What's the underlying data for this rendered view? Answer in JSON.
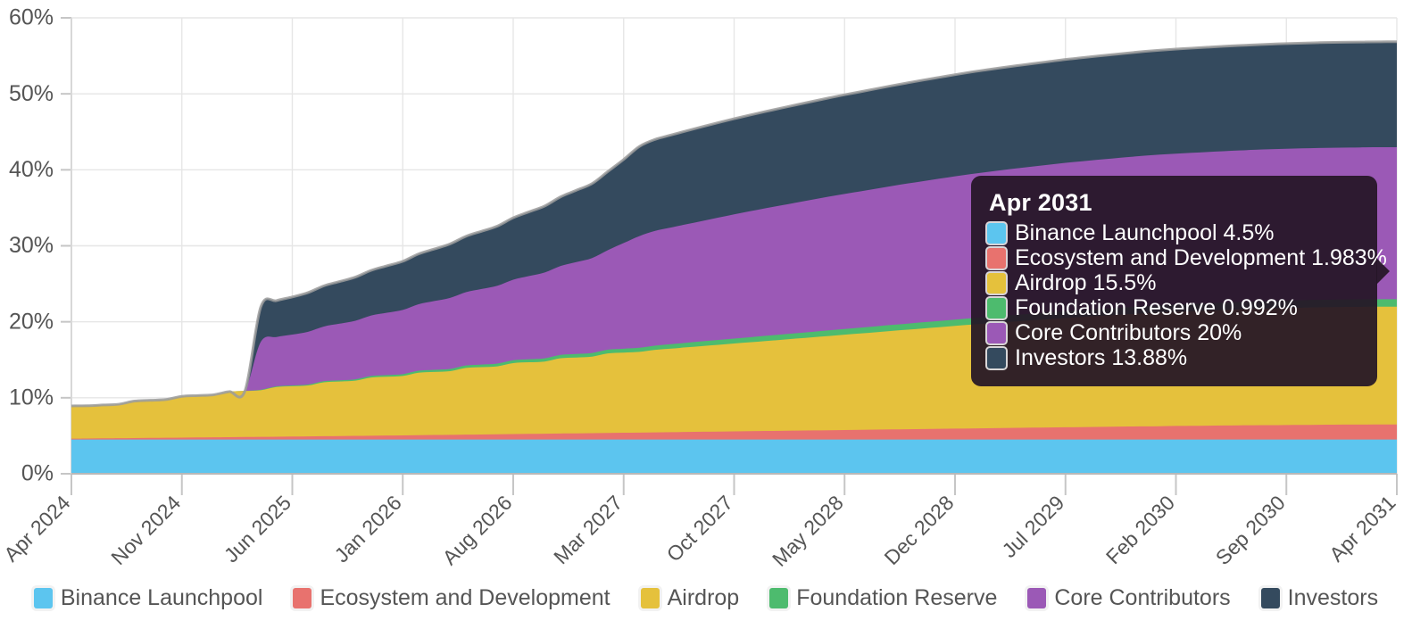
{
  "chart_data": {
    "type": "area",
    "title": "",
    "xlabel": "",
    "ylabel": "",
    "stacked": true,
    "grid": true,
    "legend_position": "bottom",
    "ylim": [
      0,
      60
    ],
    "ytick_labels": [
      "0%",
      "10%",
      "20%",
      "30%",
      "40%",
      "50%",
      "60%"
    ],
    "ytick_values": [
      0,
      10,
      20,
      30,
      40,
      50,
      60
    ],
    "xtick_labels": [
      "Apr 2024",
      "Nov 2024",
      "Jun 2025",
      "Jan 2026",
      "Aug 2026",
      "Mar 2027",
      "Oct 2027",
      "May 2028",
      "Dec 2028",
      "Jul 2029",
      "Feb 2030",
      "Sep 2030",
      "Apr 2031"
    ],
    "x": [
      "Apr 2024",
      "May 2024",
      "Jun 2024",
      "Jul 2024",
      "Aug 2024",
      "Sep 2024",
      "Oct 2024",
      "Nov 2024",
      "Dec 2024",
      "Jan 2025",
      "Feb 2025",
      "Mar 2025",
      "Apr 2025",
      "May 2025",
      "Jun 2025",
      "Jul 2025",
      "Aug 2025",
      "Sep 2025",
      "Oct 2025",
      "Nov 2025",
      "Dec 2025",
      "Jan 2026",
      "Feb 2026",
      "Mar 2026",
      "Apr 2026",
      "May 2026",
      "Jun 2026",
      "Jul 2026",
      "Aug 2026",
      "Sep 2026",
      "Oct 2026",
      "Nov 2026",
      "Dec 2026",
      "Jan 2027",
      "Feb 2027",
      "Mar 2027",
      "Apr 2027",
      "May 2027",
      "Jun 2027",
      "Jul 2027",
      "Aug 2027",
      "Sep 2027",
      "Oct 2027",
      "Nov 2027",
      "Dec 2027",
      "Jan 2028",
      "Feb 2028",
      "Mar 2028",
      "Apr 2028",
      "May 2028",
      "Jun 2028",
      "Jul 2028",
      "Aug 2028",
      "Sep 2028",
      "Oct 2028",
      "Nov 2028",
      "Dec 2028",
      "Jan 2029",
      "Feb 2029",
      "Mar 2029",
      "Apr 2029",
      "May 2029",
      "Jun 2029",
      "Jul 2029",
      "Aug 2029",
      "Sep 2029",
      "Oct 2029",
      "Nov 2029",
      "Dec 2029",
      "Jan 2030",
      "Feb 2030",
      "Mar 2030",
      "Apr 2030",
      "May 2030",
      "Jun 2030",
      "Jul 2030",
      "Aug 2030",
      "Sep 2030",
      "Oct 2030",
      "Nov 2030",
      "Dec 2030",
      "Jan 2031",
      "Feb 2031",
      "Mar 2031",
      "Apr 2031"
    ],
    "series": [
      {
        "name": "Binance Launchpool",
        "color": "#5cc5ef",
        "final_value": 4.5,
        "values": [
          4.5,
          4.5,
          4.5,
          4.5,
          4.5,
          4.5,
          4.5,
          4.5,
          4.5,
          4.5,
          4.5,
          4.5,
          4.5,
          4.5,
          4.5,
          4.5,
          4.5,
          4.5,
          4.5,
          4.5,
          4.5,
          4.5,
          4.5,
          4.5,
          4.5,
          4.5,
          4.5,
          4.5,
          4.5,
          4.5,
          4.5,
          4.5,
          4.5,
          4.5,
          4.5,
          4.5,
          4.5,
          4.5,
          4.5,
          4.5,
          4.5,
          4.5,
          4.5,
          4.5,
          4.5,
          4.5,
          4.5,
          4.5,
          4.5,
          4.5,
          4.5,
          4.5,
          4.5,
          4.5,
          4.5,
          4.5,
          4.5,
          4.5,
          4.5,
          4.5,
          4.5,
          4.5,
          4.5,
          4.5,
          4.5,
          4.5,
          4.5,
          4.5,
          4.5,
          4.5,
          4.5,
          4.5,
          4.5,
          4.5,
          4.5,
          4.5,
          4.5,
          4.5,
          4.5,
          4.5,
          4.5,
          4.5,
          4.5,
          4.5,
          4.5
        ]
      },
      {
        "name": "Ecosystem and Development",
        "color": "#e8726e",
        "final_value": 1.983,
        "values": [
          0.12,
          0.14,
          0.16,
          0.18,
          0.2,
          0.22,
          0.24,
          0.26,
          0.28,
          0.3,
          0.32,
          0.34,
          0.36,
          0.38,
          0.4,
          0.42,
          0.44,
          0.46,
          0.49,
          0.51,
          0.53,
          0.55,
          0.58,
          0.6,
          0.62,
          0.65,
          0.67,
          0.7,
          0.72,
          0.75,
          0.77,
          0.8,
          0.82,
          0.85,
          0.87,
          0.9,
          0.92,
          0.95,
          0.97,
          1.0,
          1.03,
          1.05,
          1.08,
          1.1,
          1.13,
          1.15,
          1.18,
          1.21,
          1.23,
          1.26,
          1.28,
          1.31,
          1.34,
          1.36,
          1.39,
          1.41,
          1.44,
          1.46,
          1.49,
          1.52,
          1.54,
          1.57,
          1.59,
          1.62,
          1.64,
          1.67,
          1.69,
          1.72,
          1.74,
          1.76,
          1.79,
          1.81,
          1.83,
          1.85,
          1.87,
          1.89,
          1.9,
          1.92,
          1.93,
          1.95,
          1.96,
          1.97,
          1.975,
          1.98,
          1.983
        ]
      },
      {
        "name": "Airdrop",
        "color": "#e5c13c",
        "final_value": 15.5,
        "values": [
          4.3,
          4.3,
          4.38,
          4.46,
          4.86,
          4.94,
          5.02,
          5.42,
          5.5,
          5.58,
          5.98,
          6.06,
          6.14,
          6.54,
          6.62,
          6.7,
          7.1,
          7.18,
          7.26,
          7.66,
          7.74,
          7.82,
          8.22,
          8.3,
          8.38,
          8.78,
          8.86,
          8.94,
          9.34,
          9.42,
          9.5,
          9.9,
          9.98,
          10.06,
          10.46,
          10.54,
          10.62,
          10.85,
          11.0,
          11.14,
          11.28,
          11.42,
          11.56,
          11.7,
          11.84,
          11.98,
          12.12,
          12.26,
          12.4,
          12.54,
          12.68,
          12.82,
          12.96,
          13.1,
          13.24,
          13.38,
          13.52,
          13.66,
          13.78,
          13.9,
          14.02,
          14.14,
          14.26,
          14.38,
          14.48,
          14.58,
          14.68,
          14.78,
          14.88,
          14.96,
          15.02,
          15.08,
          15.14,
          15.2,
          15.26,
          15.31,
          15.36,
          15.4,
          15.43,
          15.45,
          15.47,
          15.48,
          15.49,
          15.5,
          15.5
        ]
      },
      {
        "name": "Foundation Reserve",
        "color": "#4dbb6e",
        "final_value": 0.992,
        "values": [
          0.01,
          0.01,
          0.01,
          0.01,
          0.01,
          0.01,
          0.01,
          0.01,
          0.01,
          0.01,
          0.01,
          0.01,
          0.05,
          0.08,
          0.1,
          0.12,
          0.14,
          0.16,
          0.18,
          0.2,
          0.22,
          0.24,
          0.26,
          0.28,
          0.3,
          0.32,
          0.34,
          0.36,
          0.38,
          0.4,
          0.42,
          0.44,
          0.46,
          0.48,
          0.5,
          0.52,
          0.54,
          0.56,
          0.58,
          0.6,
          0.62,
          0.64,
          0.65,
          0.67,
          0.68,
          0.7,
          0.71,
          0.72,
          0.74,
          0.75,
          0.76,
          0.77,
          0.79,
          0.8,
          0.81,
          0.82,
          0.83,
          0.84,
          0.85,
          0.86,
          0.87,
          0.88,
          0.89,
          0.9,
          0.91,
          0.92,
          0.925,
          0.93,
          0.94,
          0.945,
          0.95,
          0.955,
          0.96,
          0.963,
          0.966,
          0.97,
          0.973,
          0.976,
          0.979,
          0.982,
          0.984,
          0.986,
          0.988,
          0.99,
          0.992
        ]
      },
      {
        "name": "Core Contributors",
        "color": "#9b59b6",
        "final_value": 20.0,
        "values": [
          0,
          0,
          0,
          0,
          0,
          0,
          0,
          0,
          0,
          0,
          0,
          0,
          6.3,
          6.5,
          6.7,
          6.95,
          7.2,
          7.45,
          7.7,
          7.95,
          8.2,
          8.45,
          8.75,
          9.05,
          9.35,
          9.65,
          9.95,
          10.25,
          10.6,
          10.95,
          11.3,
          11.7,
          12.1,
          12.5,
          13.1,
          13.9,
          14.7,
          15.1,
          15.35,
          15.6,
          15.85,
          16.1,
          16.35,
          16.58,
          16.8,
          17.0,
          17.2,
          17.4,
          17.6,
          17.78,
          17.95,
          18.12,
          18.28,
          18.44,
          18.58,
          18.72,
          18.85,
          18.98,
          19.08,
          19.18,
          19.28,
          19.36,
          19.44,
          19.52,
          19.58,
          19.64,
          19.7,
          19.75,
          19.8,
          19.84,
          19.87,
          19.9,
          19.92,
          19.94,
          19.95,
          19.96,
          19.97,
          19.98,
          19.985,
          19.99,
          19.99,
          19.995,
          20.0,
          20.0,
          20.0
        ]
      },
      {
        "name": "Investors",
        "color": "#344a5e",
        "final_value": 13.88,
        "values": [
          0,
          0,
          0,
          0,
          0,
          0,
          0,
          0,
          0,
          0,
          0,
          0,
          4.6,
          4.78,
          4.95,
          5.15,
          5.35,
          5.55,
          5.75,
          5.95,
          6.18,
          6.4,
          6.62,
          6.85,
          7.1,
          7.35,
          7.6,
          7.85,
          8.15,
          8.45,
          8.75,
          9.1,
          9.45,
          9.8,
          10.35,
          11.0,
          11.8,
          12.05,
          12.18,
          12.3,
          12.4,
          12.5,
          12.58,
          12.66,
          12.73,
          12.8,
          12.87,
          12.93,
          12.99,
          13.05,
          13.1,
          13.15,
          13.2,
          13.25,
          13.3,
          13.34,
          13.38,
          13.42,
          13.46,
          13.49,
          13.52,
          13.55,
          13.58,
          13.61,
          13.63,
          13.65,
          13.68,
          13.7,
          13.72,
          13.74,
          13.76,
          13.77,
          13.79,
          13.8,
          13.81,
          13.82,
          13.83,
          13.84,
          13.85,
          13.86,
          13.86,
          13.87,
          13.87,
          13.88,
          13.88
        ]
      }
    ]
  },
  "tooltip": {
    "title": "Apr 2031",
    "rows": [
      {
        "color": "#5cc5ef",
        "text": "Binance Launchpool 4.5%"
      },
      {
        "color": "#e8726e",
        "text": "Ecosystem and Development 1.983%"
      },
      {
        "color": "#e5c13c",
        "text": "Airdrop 15.5%"
      },
      {
        "color": "#4dbb6e",
        "text": "Foundation Reserve 0.992%"
      },
      {
        "color": "#9b59b6",
        "text": "Core Contributors 20%"
      },
      {
        "color": "#344a5e",
        "text": "Investors 13.88%"
      }
    ]
  },
  "legend": {
    "items": [
      {
        "color": "#5cc5ef",
        "label": "Binance Launchpool"
      },
      {
        "color": "#e8726e",
        "label": "Ecosystem and Development"
      },
      {
        "color": "#e5c13c",
        "label": "Airdrop"
      },
      {
        "color": "#4dbb6e",
        "label": "Foundation Reserve"
      },
      {
        "color": "#9b59b6",
        "label": "Core Contributors"
      },
      {
        "color": "#344a5e",
        "label": "Investors"
      }
    ]
  }
}
